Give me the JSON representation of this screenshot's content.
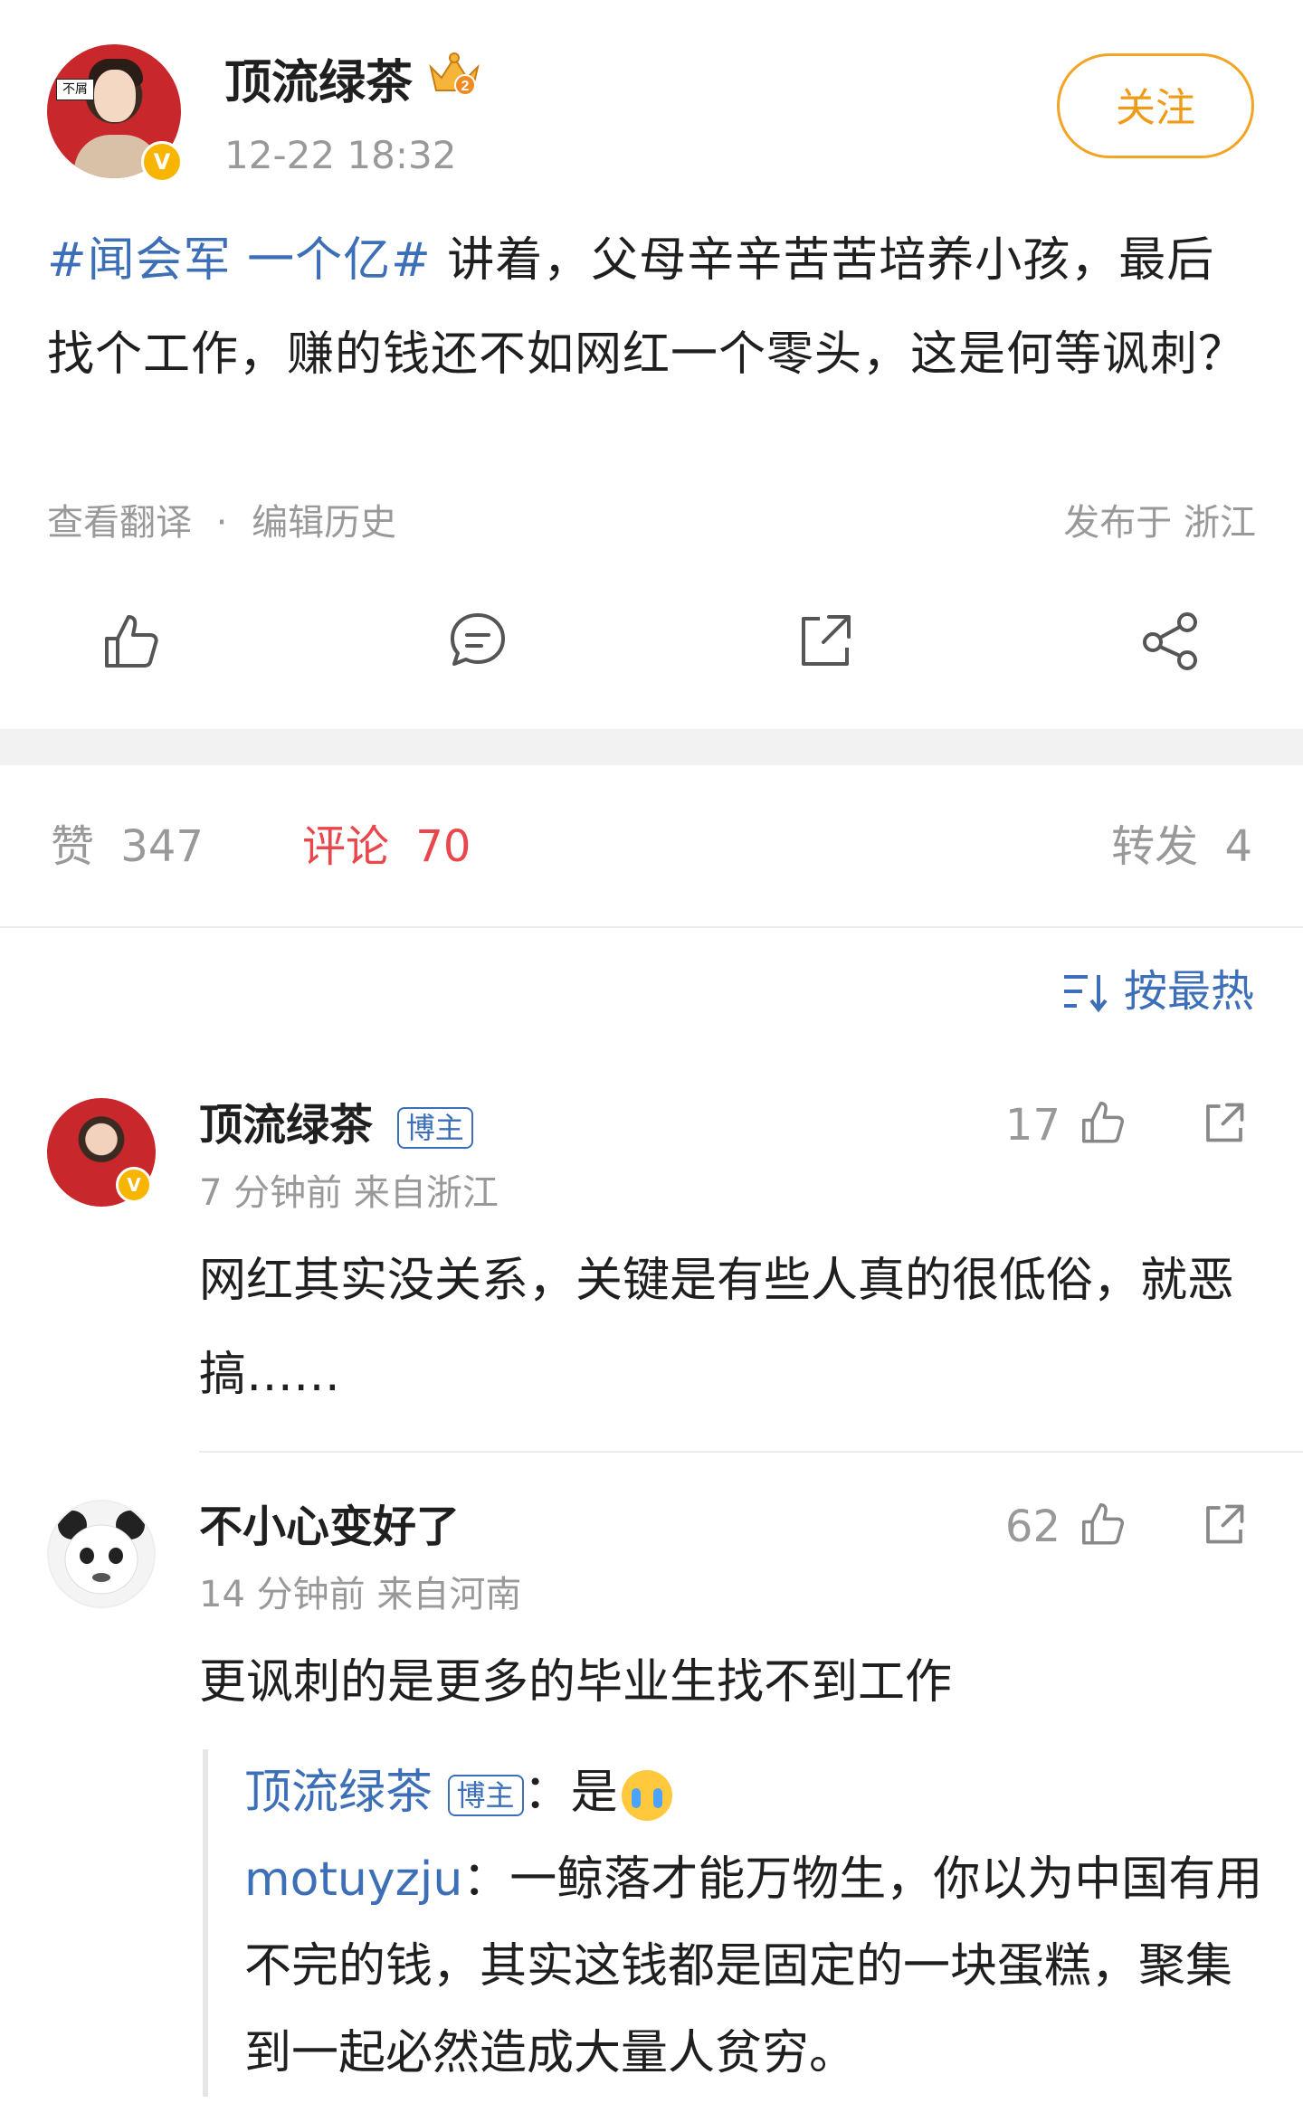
{
  "post": {
    "author": "顶流绿茶",
    "time": "12-22 18:32",
    "follow_label": "关注",
    "hashtag": "#闻会军 一个亿#",
    "text": " 讲着，父母辛辛苦苦培养小孩，最后找个工作，赚的钱还不如网红一个零头，这是何等讽刺？",
    "translate_label": "查看翻译",
    "sep": "·",
    "history_label": "编辑历史",
    "location": "发布于 浙江",
    "avatar_tag": "不屑",
    "vip_mark": "V"
  },
  "tabs": {
    "likes_label": "赞",
    "likes_count": "347",
    "comments_label": "评论",
    "comments_count": "70",
    "reposts_label": "转发",
    "reposts_count": "4"
  },
  "sort_label": "按最热",
  "comments": [
    {
      "name": "顶流绿茶",
      "badge": "博主",
      "meta": "7 分钟前  来自浙江",
      "likes": "17",
      "text": "网红其实没关系，关键是有些人真的很低俗，就恶搞……"
    },
    {
      "name": "不小心变好了",
      "meta": "14 分钟前  来自河南",
      "likes": "62",
      "text": "更讽刺的是更多的毕业生找不到工作",
      "replies": [
        {
          "name": "顶流绿茶",
          "badge": "博主",
          "text": "：是"
        },
        {
          "name": "motuyzju",
          "text": "：一鲸落才能万物生，你以为中国有用不完的钱，其实这钱都是固定的一块蛋糕，聚集到一起必然造成大量人贫穷。"
        }
      ]
    }
  ],
  "icons": [
    "like-icon",
    "comment-icon",
    "repost-icon",
    "share-icon",
    "sort-icon",
    "crown-badge-icon",
    "verified-icon"
  ],
  "colors": {
    "accent_blue": "#3c6fb7",
    "active_red": "#e9474c",
    "follow_orange": "#f4a323",
    "gray_text": "#999999"
  }
}
